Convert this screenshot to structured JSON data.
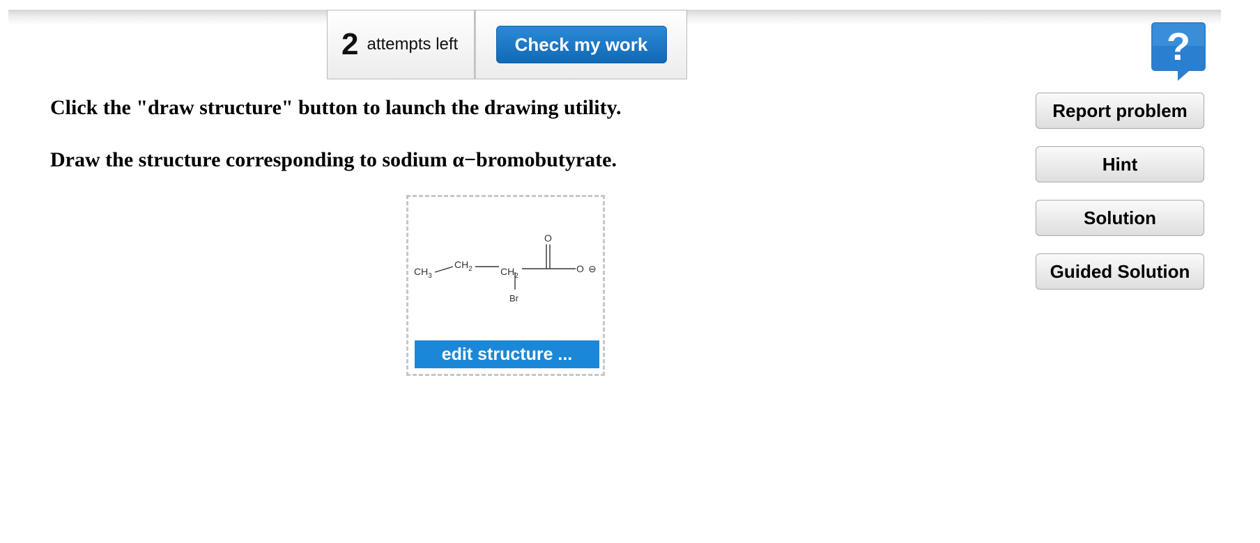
{
  "attempts": {
    "count": "2",
    "label": "attempts left"
  },
  "check_button_label": "Check my work",
  "help_icon": {
    "name": "question-mark-help-icon",
    "glyph": "?",
    "color": "#2a7fd0"
  },
  "instructions": {
    "line1": "Click the \"draw structure\" button to launch the drawing utility.",
    "line2": "Draw the structure corresponding to sodium α−bromobutyrate."
  },
  "sidebar_buttons": {
    "report": "Report problem",
    "hint": "Hint",
    "solution": "Solution",
    "guided": "Guided Solution"
  },
  "structure": {
    "atoms": {
      "ch3": "CH",
      "ch3_sub": "3",
      "ch2_a": "CH",
      "ch2_a_sub": "2",
      "ch2_b": "CH",
      "ch2_b_sub": "2",
      "br": "Br",
      "o_double": "O",
      "o_single": "O",
      "charge": "⊖"
    },
    "edit_button_label": "edit structure ..."
  },
  "colors": {
    "accent": "#1b87d6",
    "check_button": "#1a73c2"
  }
}
